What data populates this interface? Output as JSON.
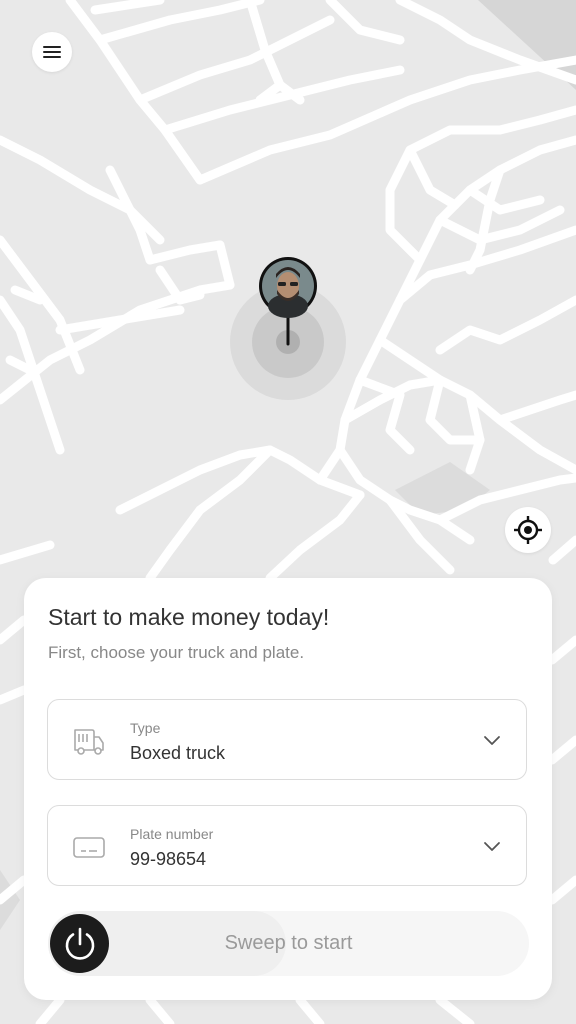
{
  "header": {
    "menu_icon": "hamburger-icon"
  },
  "map": {
    "locate_icon": "crosshair-icon",
    "pin_avatar": "driver-avatar"
  },
  "card": {
    "title": "Start to make money today!",
    "subtitle": "First, choose your truck and plate.",
    "type_field": {
      "label": "Type",
      "value": "Boxed truck",
      "icon": "truck-icon"
    },
    "plate_field": {
      "label": "Plate number",
      "value": "99-98654",
      "icon": "license-plate-icon"
    },
    "sweep": {
      "label": "Sweep to start",
      "icon": "power-icon"
    }
  },
  "colors": {
    "map_bg": "#e9e9e9",
    "road": "#ffffff",
    "accent_dark": "#1c1c1c",
    "card_bg": "#ffffff"
  }
}
